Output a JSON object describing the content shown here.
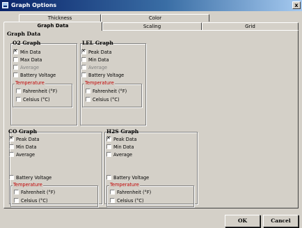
{
  "window": {
    "title": "Graph Options",
    "close_label": "x"
  },
  "tabs_back": [
    {
      "label": "Thickness"
    },
    {
      "label": "Color"
    }
  ],
  "tabs_front": [
    {
      "label": "Graph Data"
    },
    {
      "label": "Scaling"
    },
    {
      "label": "Grid"
    }
  ],
  "panel": {
    "title": "Graph Data"
  },
  "groups": {
    "o2": {
      "title": "O2 Graph",
      "items": [
        {
          "label": "Min Data",
          "checked": true,
          "enabled": true
        },
        {
          "label": "Max Data",
          "checked": false,
          "enabled": true
        },
        {
          "label": "Average",
          "checked": false,
          "enabled": false
        },
        {
          "label": "Battery Voltage",
          "checked": false,
          "enabled": true
        }
      ],
      "temperature": {
        "title": "Temperature",
        "items": [
          {
            "label": "Fahrenheit (°F)",
            "checked": false
          },
          {
            "label": "Celsius (°C)",
            "checked": false
          }
        ]
      }
    },
    "lel": {
      "title": "LEL Graph",
      "items": [
        {
          "label": "Peak Data",
          "checked": true,
          "enabled": true
        },
        {
          "label": "Min Data",
          "checked": false,
          "enabled": true
        },
        {
          "label": "Average",
          "checked": false,
          "enabled": false
        },
        {
          "label": "Battery Voltage",
          "checked": false,
          "enabled": true
        }
      ],
      "temperature": {
        "title": "Temperature",
        "items": [
          {
            "label": "Fahrenheit (°F)",
            "checked": false
          },
          {
            "label": "Celsius (°C)",
            "checked": false
          }
        ]
      }
    },
    "co": {
      "title": "CO Graph",
      "items": [
        {
          "label": "Peak Data",
          "checked": true,
          "enabled": true
        },
        {
          "label": "Min Data",
          "checked": false,
          "enabled": true
        },
        {
          "label": "Average",
          "checked": false,
          "enabled": true
        },
        {
          "label": "Battery Voltage",
          "checked": false,
          "enabled": true
        }
      ],
      "temperature": {
        "title": "Temperature",
        "items": [
          {
            "label": "Fahrenheit (°F)",
            "checked": false
          },
          {
            "label": "Celsius (°C)",
            "checked": false
          }
        ]
      }
    },
    "h2s": {
      "title": "H2S Graph",
      "items": [
        {
          "label": "Peak Data",
          "checked": true,
          "enabled": true
        },
        {
          "label": "Min Data",
          "checked": false,
          "enabled": true
        },
        {
          "label": "Average",
          "checked": false,
          "enabled": true
        },
        {
          "label": "Battery Voltage",
          "checked": false,
          "enabled": true
        }
      ],
      "temperature": {
        "title": "Temperature",
        "items": [
          {
            "label": "Fahrenheit (°F)",
            "checked": false
          },
          {
            "label": "Celsius (°C)",
            "checked": false
          }
        ]
      }
    }
  },
  "buttons": {
    "ok": "OK",
    "cancel": "Cancel"
  },
  "colors": {
    "temperature_label": "#c00000",
    "title_bar": "#0a246a",
    "dialog_face": "#d4d0c8"
  }
}
